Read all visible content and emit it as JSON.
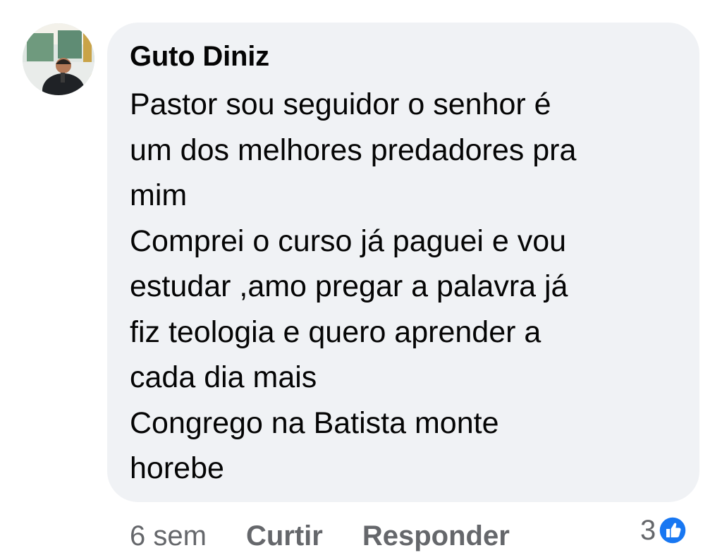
{
  "comment": {
    "author": "Guto Diniz",
    "avatar_icon": "user-photo-avatar",
    "text": "Pastor sou seguidor o senhor é\num dos melhores predadores pra\nmim\nComprei o curso já paguei e vou\nestudar  ,amo pregar a palavra já\nfiz teologia e quero aprender a\ncada dia mais\nCongrego na Batista monte\nhorebe"
  },
  "actions": {
    "timestamp": "6 sem",
    "like_label": "Curtir",
    "reply_label": "Responder"
  },
  "reactions": {
    "count": "3",
    "icon": "thumbs-up-icon",
    "color": "#1877f2"
  },
  "colors": {
    "bubble": "#f0f2f5",
    "text": "#050505",
    "secondary": "#65676b"
  }
}
